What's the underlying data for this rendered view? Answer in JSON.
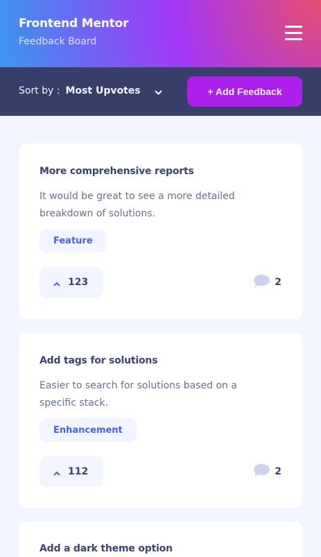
{
  "header": {
    "title": "Frontend Mentor",
    "subtitle": "Feedback Board",
    "menu_icon": "hamburger-icon"
  },
  "toolbar": {
    "sort_label": "Sort by :",
    "sort_value": "Most Upvotes",
    "sort_icon": "chevron-down-icon",
    "add_button_label": "+ Add Feedback"
  },
  "colors": {
    "background": "#f2f4ff",
    "toolbar": "#373f68",
    "primary_button": "#ad1fea",
    "tag_text": "#4661e6",
    "title_text": "#3a4374",
    "body_text": "#647196"
  },
  "feedback": [
    {
      "title": "More comprehensive reports",
      "description": "It would be great to see a more detailed breakdown of solutions.",
      "tag": "Feature",
      "upvotes": "123",
      "comments": "2"
    },
    {
      "title": "Add tags for solutions",
      "description": "Easier to search for solutions based on a specific stack.",
      "tag": "Enhancement",
      "upvotes": "112",
      "comments": "2"
    },
    {
      "title": "Add a dark theme option"
    }
  ]
}
